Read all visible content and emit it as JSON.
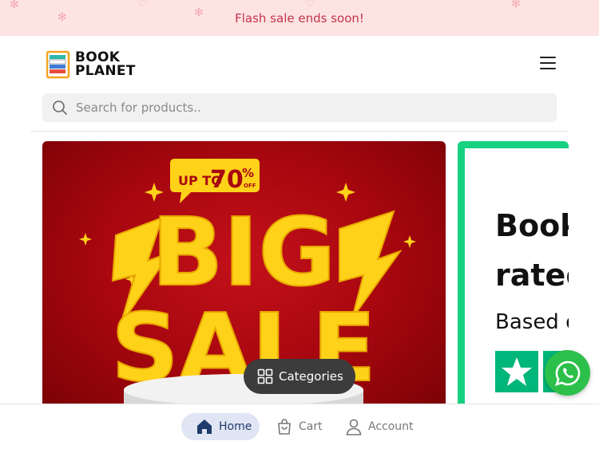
{
  "announcement": {
    "text": "Flash sale ends soon!"
  },
  "header": {
    "logo_line1": "BOOK",
    "logo_line2": "PLANET",
    "menu_icon": "hamburger-menu-icon"
  },
  "search": {
    "placeholder": "Search for products.."
  },
  "banners": [
    {
      "badge_up_to": "UP TO",
      "badge_percent": "70",
      "badge_symbol": "%",
      "badge_off": "OFF",
      "headline1": "BIG",
      "headline2": "SALE"
    },
    {
      "line1": "Book",
      "line2": "rated",
      "line3": "Based on"
    }
  ],
  "categories_button": {
    "label": "Categories",
    "icon": "grid-icon"
  },
  "whatsapp": {
    "icon": "whatsapp-icon"
  },
  "bottom_nav": {
    "items": [
      {
        "label": "Home",
        "icon": "home-icon",
        "active": true
      },
      {
        "label": "Cart",
        "icon": "cart-icon",
        "active": false
      },
      {
        "label": "Account",
        "icon": "user-icon",
        "active": false
      }
    ]
  },
  "colors": {
    "announcement_bg": "#fde4e3",
    "announcement_text": "#c4344a",
    "sale_red": "#a8070f",
    "sale_yellow": "#ffd21a",
    "trustpilot_green": "#00b67a",
    "whatsapp_green": "#2cc04a",
    "nav_active_bg": "#dfe5f3",
    "nav_active_text": "#1f3a6b"
  }
}
